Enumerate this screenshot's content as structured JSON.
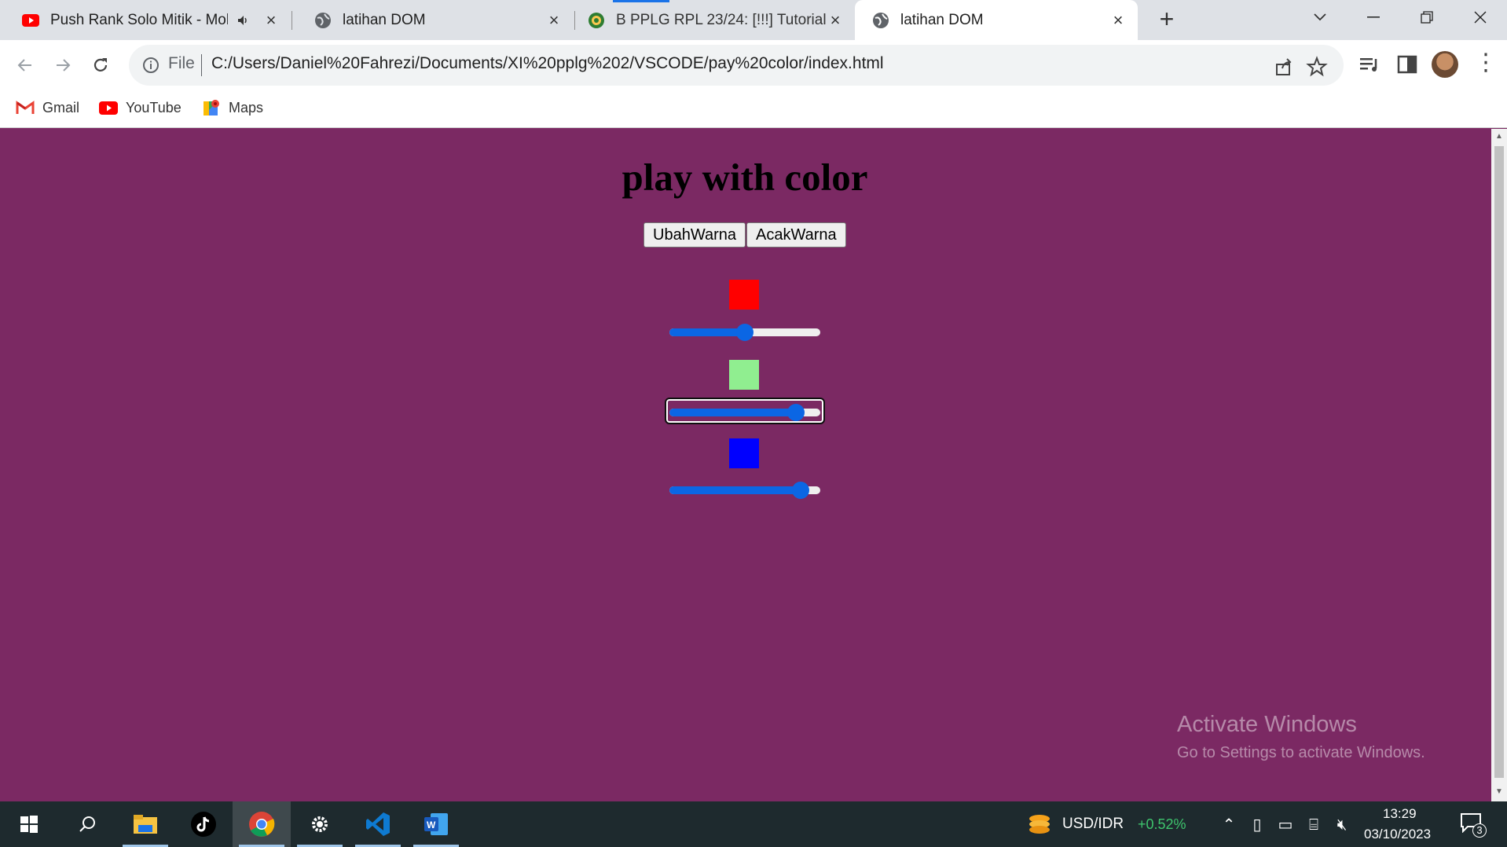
{
  "browser": {
    "tabs": [
      {
        "title": "Push Rank Solo Mitik - Mob",
        "icon": "youtube-icon",
        "muted_icon": "speaker-icon"
      },
      {
        "title": "latihan DOM",
        "icon": "globe-icon"
      },
      {
        "title": "B PPLG RPL 23/24: [!!!] Tutorial M",
        "icon": "classroom-icon"
      },
      {
        "title": "latihan DOM",
        "icon": "globe-icon",
        "active": true
      }
    ],
    "address": {
      "scheme_label": "File",
      "url": "C:/Users/Daniel%20Fahrezi/Documents/XI%20pplg%202/VSCODE/pay%20color/index.html"
    },
    "bookmarks": [
      {
        "label": "Gmail",
        "icon": "gmail-icon"
      },
      {
        "label": "YouTube",
        "icon": "youtube-icon"
      },
      {
        "label": "Maps",
        "icon": "maps-icon"
      }
    ]
  },
  "page": {
    "heading": "play with color",
    "buttons": {
      "change": "UbahWarna",
      "random": "AcakWarna"
    },
    "background_color": "#7b2963",
    "swatches": [
      {
        "name": "red",
        "color": "#ff0000"
      },
      {
        "name": "green",
        "color": "#90ee90"
      },
      {
        "name": "blue",
        "color": "#0000ff"
      }
    ],
    "sliders": [
      {
        "name": "red",
        "value_fraction": 0.5
      },
      {
        "name": "green",
        "value_fraction": 0.88
      },
      {
        "name": "blue",
        "value_fraction": 0.92
      }
    ]
  },
  "watermark": {
    "title": "Activate Windows",
    "subtitle": "Go to Settings to activate Windows."
  },
  "taskbar": {
    "ticker_label": "USD/IDR",
    "ticker_change": "+0.52%",
    "time": "13:29",
    "date": "03/10/2023",
    "notification_count": "3"
  }
}
